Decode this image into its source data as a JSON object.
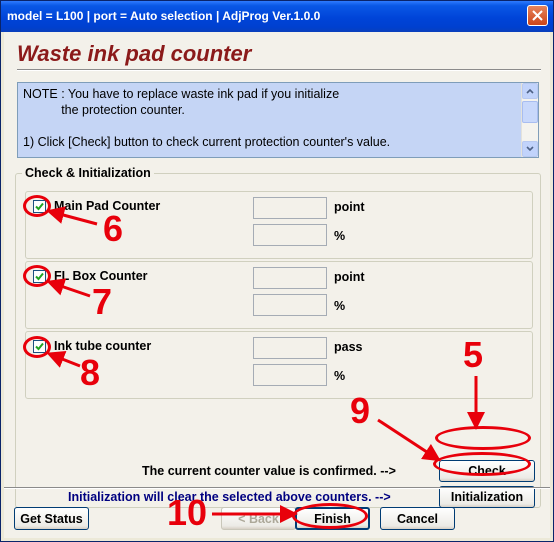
{
  "window": {
    "title": "model = L100  |  port = Auto selection  |  AdjProg Ver.1.0.0",
    "close_icon": "close-x-icon"
  },
  "heading": "Waste ink pad counter",
  "note": {
    "text": "NOTE : You have to replace waste ink pad if you initialize\n           the protection counter.\n\n1) Click [Check] button to check current protection counter's value."
  },
  "group": {
    "title": "Check & Initialization",
    "counters": [
      {
        "label": "Main Pad Counter",
        "checked": true,
        "value": "",
        "unit": "point",
        "percent": "",
        "percent_unit": "%"
      },
      {
        "label": "FL Box Counter",
        "checked": true,
        "value": "",
        "unit": "point",
        "percent": "",
        "percent_unit": "%"
      },
      {
        "label": "Ink tube counter",
        "checked": true,
        "value": "",
        "unit": "pass",
        "percent": "",
        "percent_unit": "%"
      }
    ],
    "confirm_msg": "The current counter value is confirmed. -->",
    "init_msg": "Initialization will clear the selected above counters. -->",
    "check_label": "Check",
    "init_label": "Initialization"
  },
  "footer": {
    "get_status": "Get Status",
    "back": "< Back",
    "finish": "Finish",
    "cancel": "Cancel"
  },
  "annotations": {
    "n5": "5",
    "n6": "6",
    "n7": "7",
    "n8": "8",
    "n9": "9",
    "n10": "10",
    "color": "#e8000b"
  },
  "colors": {
    "title_bar": "#0044d8",
    "heading": "#8b1a1a",
    "note_bg": "#c5d5f5",
    "init_msg": "#000080"
  }
}
